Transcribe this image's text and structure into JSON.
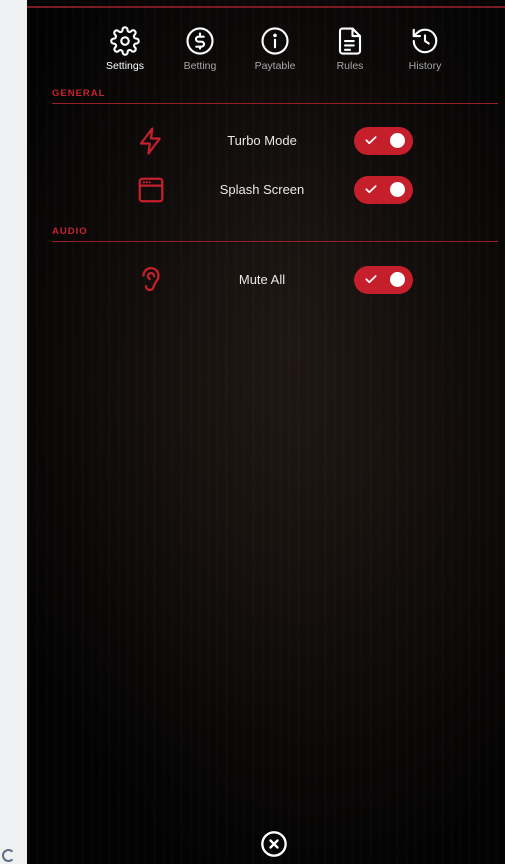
{
  "tabs": [
    {
      "label": "Settings",
      "icon": "gear-icon",
      "active": true
    },
    {
      "label": "Betting",
      "icon": "dollar-icon",
      "active": false
    },
    {
      "label": "Paytable",
      "icon": "info-icon",
      "active": false
    },
    {
      "label": "Rules",
      "icon": "document-icon",
      "active": false
    },
    {
      "label": "History",
      "icon": "history-icon",
      "active": false
    }
  ],
  "general": {
    "title": "GENERAL",
    "items": [
      {
        "label": "Turbo Mode",
        "icon": "lightning-icon",
        "enabled": true
      },
      {
        "label": "Splash Screen",
        "icon": "window-icon",
        "enabled": true
      }
    ]
  },
  "audio": {
    "title": "AUDIO",
    "items": [
      {
        "label": "Mute All",
        "icon": "ear-icon",
        "enabled": true
      }
    ]
  },
  "close": {
    "icon": "close-circle-icon"
  },
  "colors": {
    "accent": "#c61f2c",
    "section_title": "#c8222e",
    "background": "#050505",
    "text": "#e8e8e8"
  }
}
